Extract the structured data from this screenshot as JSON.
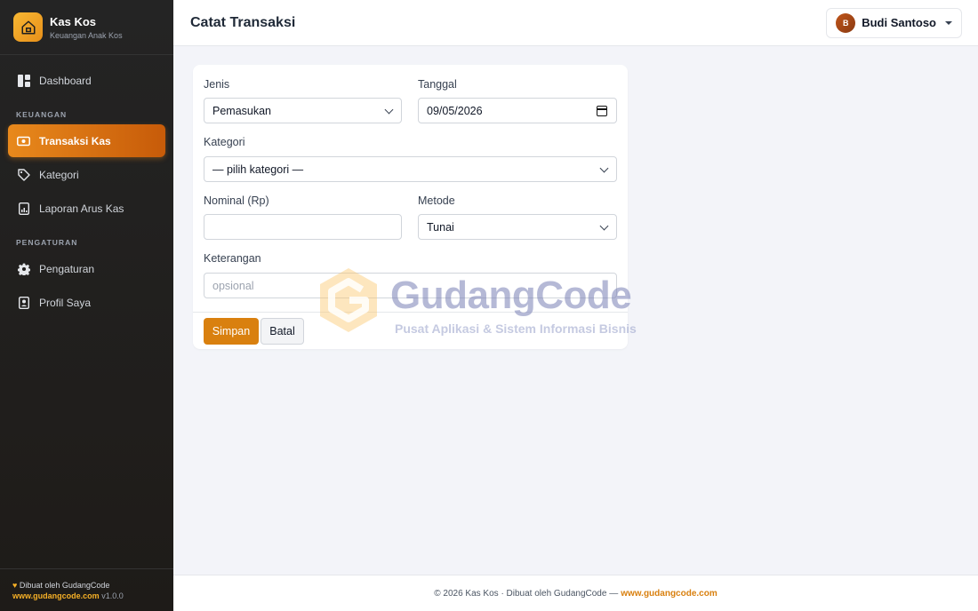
{
  "brand": {
    "title": "Kas Kos",
    "subtitle": "Keuangan Anak Kos"
  },
  "sidebar": {
    "items": [
      {
        "label": "Dashboard",
        "icon": "dashboard-icon"
      },
      {
        "label": "Transaksi Kas",
        "icon": "cash-icon",
        "active": true
      },
      {
        "label": "Kategori",
        "icon": "tag-icon"
      },
      {
        "label": "Laporan Arus Kas",
        "icon": "report-icon"
      },
      {
        "label": "Pengaturan",
        "icon": "gear-icon"
      },
      {
        "label": "Profil Saya",
        "icon": "profile-icon"
      }
    ],
    "sections": [
      "KEUANGAN",
      "PENGATURAN"
    ],
    "footer": {
      "made_by": "Dibuat oleh GudangCode",
      "site": "www.gudangcode.com",
      "version": "v1.0.0"
    }
  },
  "header": {
    "title": "Catat Transaksi",
    "user": {
      "initial": "B",
      "name": "Budi Santoso"
    }
  },
  "form": {
    "jenis": {
      "label": "Jenis",
      "value": "Pemasukan"
    },
    "tanggal": {
      "label": "Tanggal",
      "value": "09/05/2026"
    },
    "kategori": {
      "label": "Kategori",
      "value": "— pilih kategori —"
    },
    "nominal": {
      "label": "Nominal (Rp)",
      "value": ""
    },
    "metode": {
      "label": "Metode",
      "value": "Tunai"
    },
    "keterangan": {
      "label": "Keterangan",
      "placeholder": "opsional"
    },
    "save_label": "Simpan",
    "cancel_label": "Batal"
  },
  "watermark": {
    "title": "GudangCode",
    "subtitle": "Pusat Aplikasi & Sistem Informasi Bisnis"
  },
  "footer": {
    "text": "© 2026 Kas Kos · Dibuat oleh GudangCode —",
    "link": "www.gudangcode.com"
  },
  "colors": {
    "accent": "#d9800f",
    "sidebar_bg": "#242424",
    "page_bg": "#f3f4f9"
  }
}
